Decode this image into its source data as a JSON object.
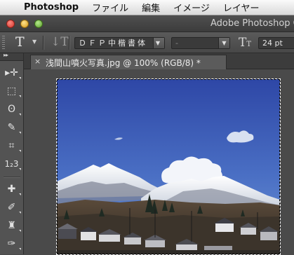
{
  "menubar": {
    "apple_icon": "",
    "app_name": "Photoshop",
    "items": [
      "ファイル",
      "編集",
      "イメージ",
      "レイヤー"
    ]
  },
  "window": {
    "title": "Adobe Photoshop C"
  },
  "options_bar": {
    "tool_icon": "T",
    "orientation_icon": "↓T",
    "font_family": "ＤＦＰ中楷書体",
    "font_style": "-",
    "size_icon": "T",
    "font_size": "24 pt"
  },
  "document": {
    "tab_close": "×",
    "tab_label": "浅間山噴火写真.jpg @ 100% (RGB/8) *"
  },
  "tools": {
    "collapse_glyph": "▸▸",
    "items": [
      {
        "name": "move-tool-icon",
        "glyph": "▸✛"
      },
      {
        "name": "marquee-tool-icon",
        "glyph": "⬚"
      },
      {
        "name": "lasso-tool-icon",
        "glyph": "ʘ"
      },
      {
        "name": "quick-selection-tool-icon",
        "glyph": "✎"
      },
      {
        "name": "crop-tool-icon",
        "glyph": "⌗"
      },
      {
        "name": "count-tool-icon",
        "glyph": "1₂3"
      },
      {
        "name": "healing-brush-tool-icon",
        "glyph": "✚"
      },
      {
        "name": "brush-tool-icon",
        "glyph": "✐"
      },
      {
        "name": "clone-stamp-tool-icon",
        "glyph": "♜"
      },
      {
        "name": "history-brush-tool-icon",
        "glyph": "✑"
      }
    ]
  },
  "colors": {
    "sky_top": "#2f4aa8",
    "sky_bottom": "#5f86d0",
    "accent_close": "#d0342c",
    "accent_min": "#d79b1a",
    "accent_zoom": "#5c9f2c"
  }
}
